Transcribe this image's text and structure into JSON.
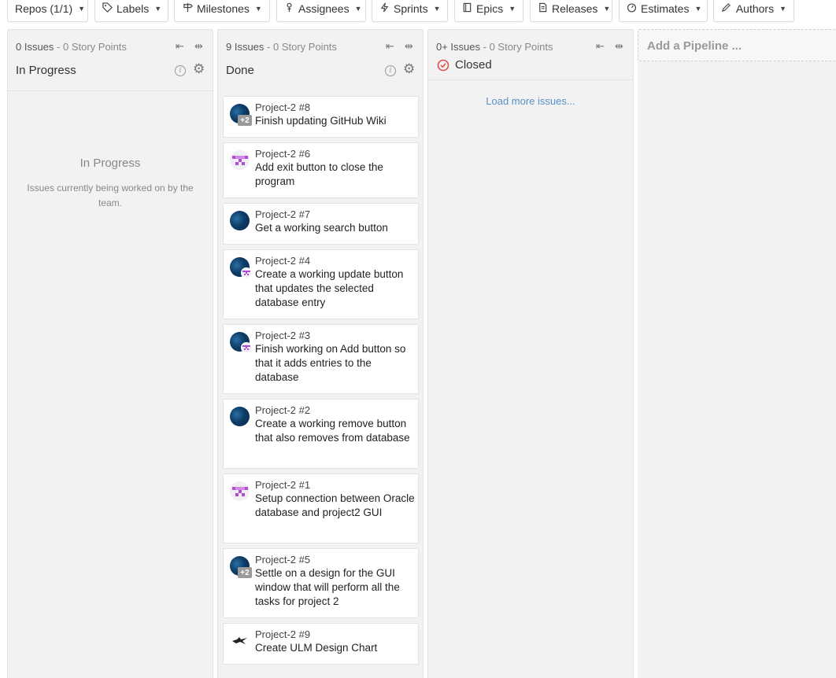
{
  "filters": [
    {
      "label": "Repos (1/1)",
      "icon": ""
    },
    {
      "label": "Labels",
      "icon": "tag-icon"
    },
    {
      "label": "Milestones",
      "icon": "signpost-icon"
    },
    {
      "label": "Assignees",
      "icon": "person-icon"
    },
    {
      "label": "Sprints",
      "icon": "bolt-icon"
    },
    {
      "label": "Epics",
      "icon": "book-icon"
    },
    {
      "label": "Releases",
      "icon": "document-icon"
    },
    {
      "label": "Estimates",
      "icon": "gauge-icon"
    },
    {
      "label": "Authors",
      "icon": "pencil-icon"
    }
  ],
  "pipelines": {
    "in_progress": {
      "count": "0 Issues",
      "points": "0 Story Points",
      "title": "In Progress",
      "empty_title": "In Progress",
      "empty_desc": "Issues currently being worked on by the team."
    },
    "done": {
      "count": "9 Issues",
      "points": "0 Story Points",
      "title": "Done",
      "cards": [
        {
          "num": "Project-2 #8",
          "title": "Finish updating GitHub Wiki",
          "avatar": "blue",
          "extra": "+2"
        },
        {
          "num": "Project-2 #6",
          "title": "Add exit button to close the program",
          "avatar": "identicon",
          "extra": ""
        },
        {
          "num": "Project-2 #7",
          "title": "Get a working search button",
          "avatar": "blue",
          "extra": ""
        },
        {
          "num": "Project-2 #4",
          "title": "Create a working update button that updates the selected database entry",
          "avatar": "blue",
          "extra": "mini"
        },
        {
          "num": "Project-2 #3",
          "title": "Finish working on Add button so that it adds entries to the database",
          "avatar": "blue",
          "extra": "mini"
        },
        {
          "num": "Project-2 #2",
          "title": "Create a working remove button that also removes from database",
          "avatar": "blue",
          "extra": ""
        },
        {
          "num": "Project-2 #1",
          "title": "Setup connection between Oracle database and project2 GUI",
          "avatar": "identicon",
          "extra": ""
        },
        {
          "num": "Project-2 #5",
          "title": "Settle on a design for the GUI window that will perform all the tasks for project 2",
          "avatar": "blue",
          "extra": "+2"
        },
        {
          "num": "Project-2 #9",
          "title": "Create ULM Design Chart",
          "avatar": "bird",
          "extra": ""
        }
      ]
    },
    "closed": {
      "count": "0+ Issues",
      "points": "0 Story Points",
      "title": "Closed",
      "load_more": "Load more issues..."
    }
  },
  "add_pipeline": "Add a Pipeline ...",
  "separator": " - ",
  "colors": {
    "closed_icon": "#d9534f",
    "link": "#5b8fc7",
    "identicon": "#b44bd6"
  }
}
